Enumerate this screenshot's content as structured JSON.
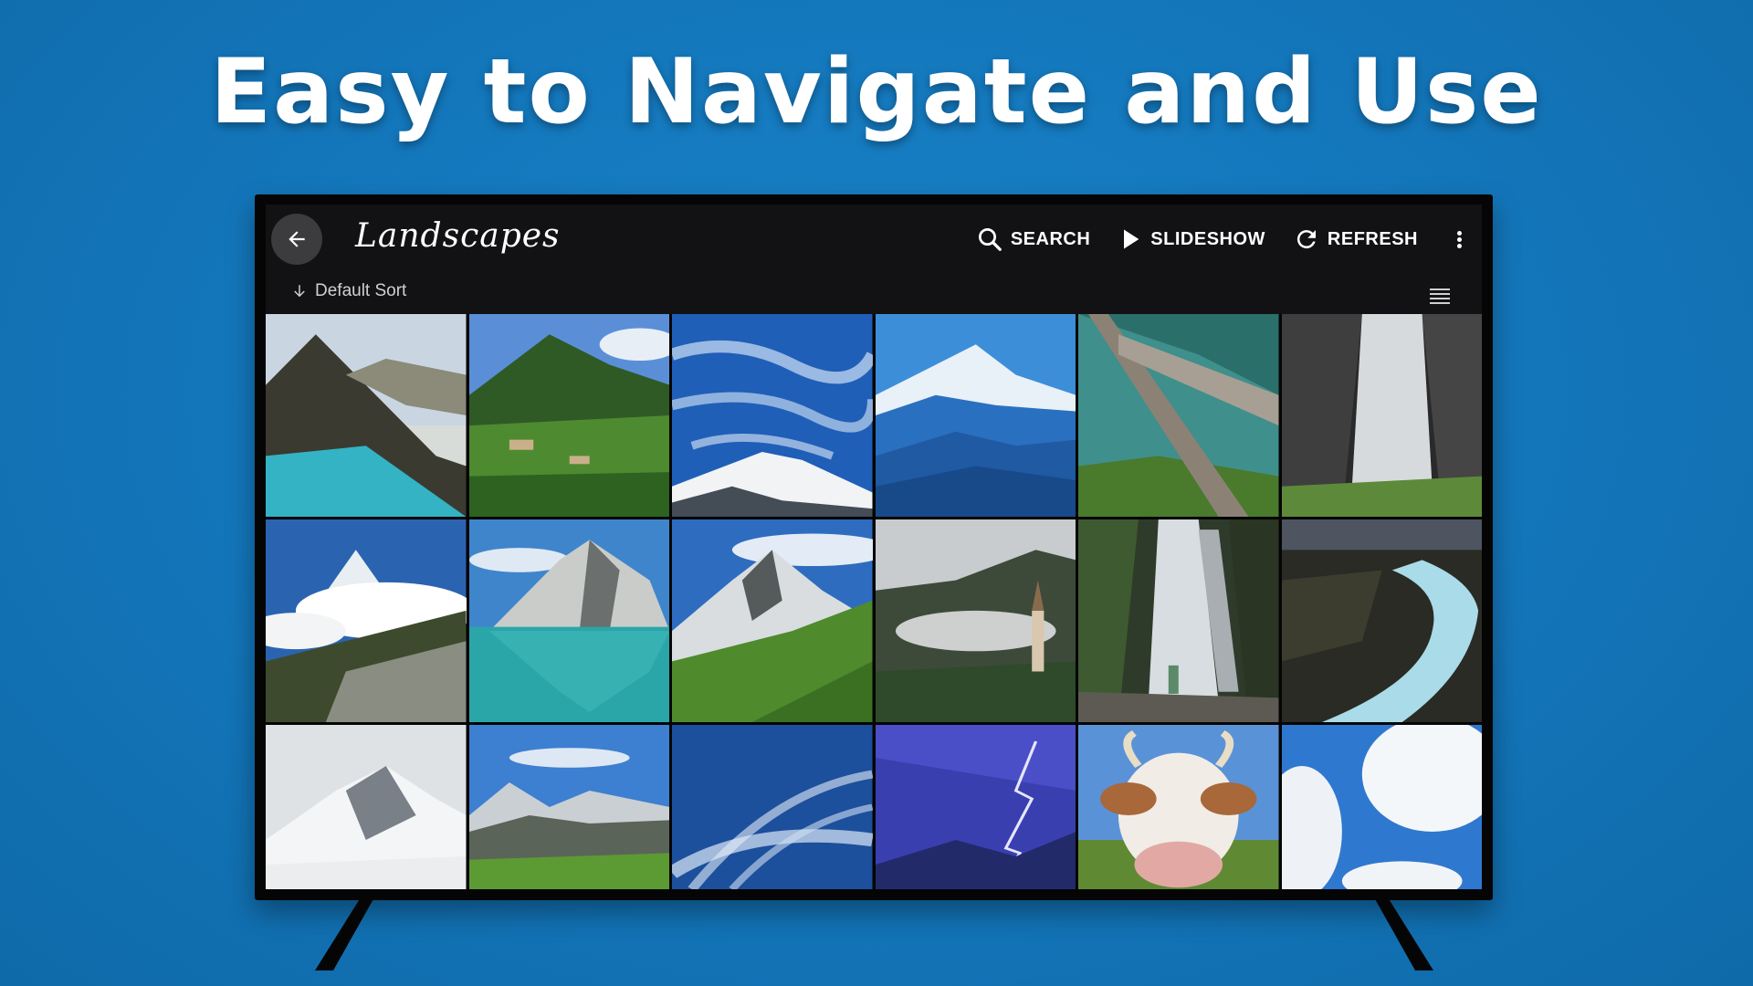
{
  "headline": "Easy to Navigate and Use",
  "app": {
    "title": "Landscapes",
    "actions": {
      "search": "SEARCH",
      "slideshow": "SLIDESHOW",
      "refresh": "REFRESH"
    },
    "sort_label": "Default Sort"
  },
  "colors": {
    "background": "#1478bd",
    "app_bg": "#121214",
    "back_button_bg": "#3c3c3e",
    "text": "#ffffff"
  },
  "icons": [
    "back-arrow-icon",
    "search-icon",
    "play-icon",
    "refresh-icon",
    "more-vert-icon",
    "arrow-down-icon",
    "list-view-icon"
  ],
  "photos": [
    "fjord-lake",
    "green-mountain-village",
    "cirrus-sky-snow-peak",
    "blue-mountain-range",
    "fallen-tree-water",
    "waterfall-cliff",
    "clouded-alpine-peak",
    "mountain-lake-reflection",
    "alpine-meadow-peak",
    "valley-church-mist",
    "hiker-waterfall",
    "glacial-river-lava",
    "snow-peak-fog",
    "alpine-valley-peaks",
    "wispy-clouds-sky",
    "lightning-storm",
    "cow-closeup",
    "white-clouds-sky"
  ]
}
